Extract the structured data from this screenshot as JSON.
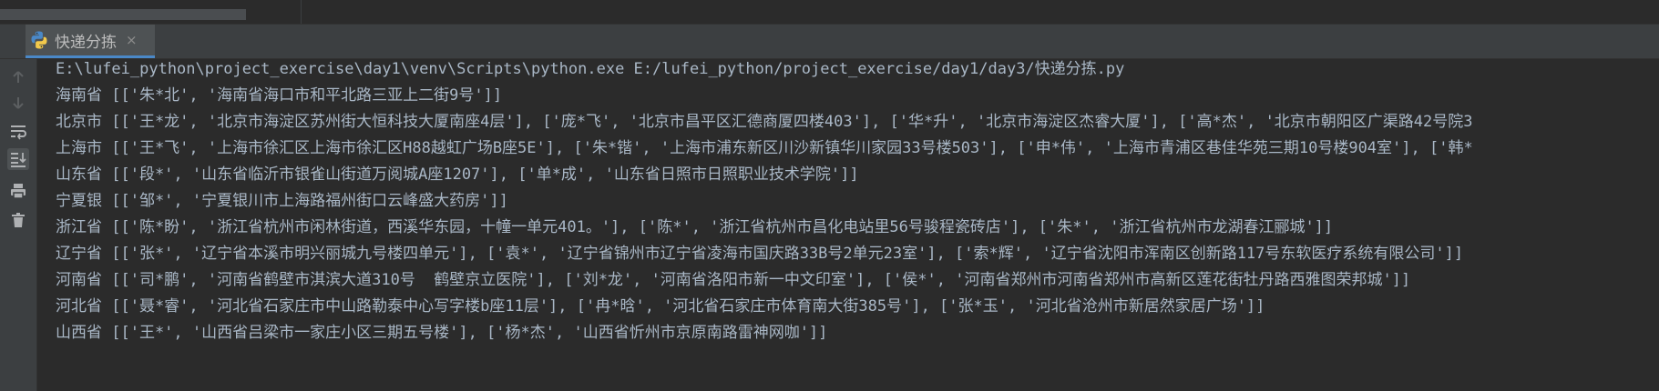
{
  "tab": {
    "label": "快递分拣",
    "close_glyph": "×"
  },
  "toolbar": {
    "items": [
      "arrow-up-icon",
      "arrow-down-icon",
      "soft-wrap-icon",
      "scroll-to-end-icon",
      "print-icon",
      "trash-icon"
    ]
  },
  "console": {
    "lines": [
      "E:\\lufei_python\\project_exercise\\day1\\venv\\Scripts\\python.exe E:/lufei_python/project_exercise/day1/day3/快递分拣.py",
      "海南省 [['朱*北', '海南省海口市和平北路三亚上二街9号']]",
      "北京市 [['王*龙', '北京市海淀区苏州街大恒科技大厦南座4层'], ['庞*飞', '北京市昌平区汇德商厦四楼403'], ['华*升', '北京市海淀区杰睿大厦'], ['高*杰', '北京市朝阳区广渠路42号院3",
      "上海市 [['王*飞', '上海市徐汇区上海市徐汇区H88越虹广场B座5E'], ['朱*锴', '上海市浦东新区川沙新镇华川家园33号楼503'], ['申*伟', '上海市青浦区巷佳华苑三期10号楼904室'], ['韩*",
      "山东省 [['段*', '山东省临沂市银雀山街道万阅城A座1207'], ['单*成', '山东省日照市日照职业技术学院']]",
      "宁夏银 [['邹*', '宁夏银川市上海路福州街口云峰盛大药房']]",
      "浙江省 [['陈*盼', '浙江省杭州市闲林街道，西溪华东园，十幢一单元401。'], ['陈*', '浙江省杭州市昌化电站里56号骏程瓷砖店'], ['朱*', '浙江省杭州市龙湖春江郦城']]",
      "辽宁省 [['张*', '辽宁省本溪市明兴丽城九号楼四单元'], ['袁*', '辽宁省锦州市辽宁省凌海市国庆路33B号2单元23室'], ['索*辉', '辽宁省沈阳市浑南区创新路117号东软医疗系统有限公司']]",
      "河南省 [['司*鹏', '河南省鹤壁市淇滨大道310号  鹤壁京立医院'], ['刘*龙', '河南省洛阳市新一中文印室'], ['侯*', '河南省郑州市河南省郑州市高新区莲花街牡丹路西雅图荣邦城']]",
      "河北省 [['聂*睿', '河北省石家庄市中山路勒泰中心写字楼b座11层'], ['冉*晗', '河北省石家庄市体育南大街385号'], ['张*玉', '河北省沧州市新居然家居广场']]",
      "山西省 [['王*', '山西省吕梁市一家庄小区三期五号楼'], ['杨*杰', '山西省忻州市京原南路雷神网咖']]"
    ]
  },
  "colors": {
    "background": "#2b2b2b",
    "panel": "#3c3f41",
    "text": "#a9b7c6",
    "tab_active_underline": "#4a88c7",
    "icon_gray": "#afb1b3"
  }
}
